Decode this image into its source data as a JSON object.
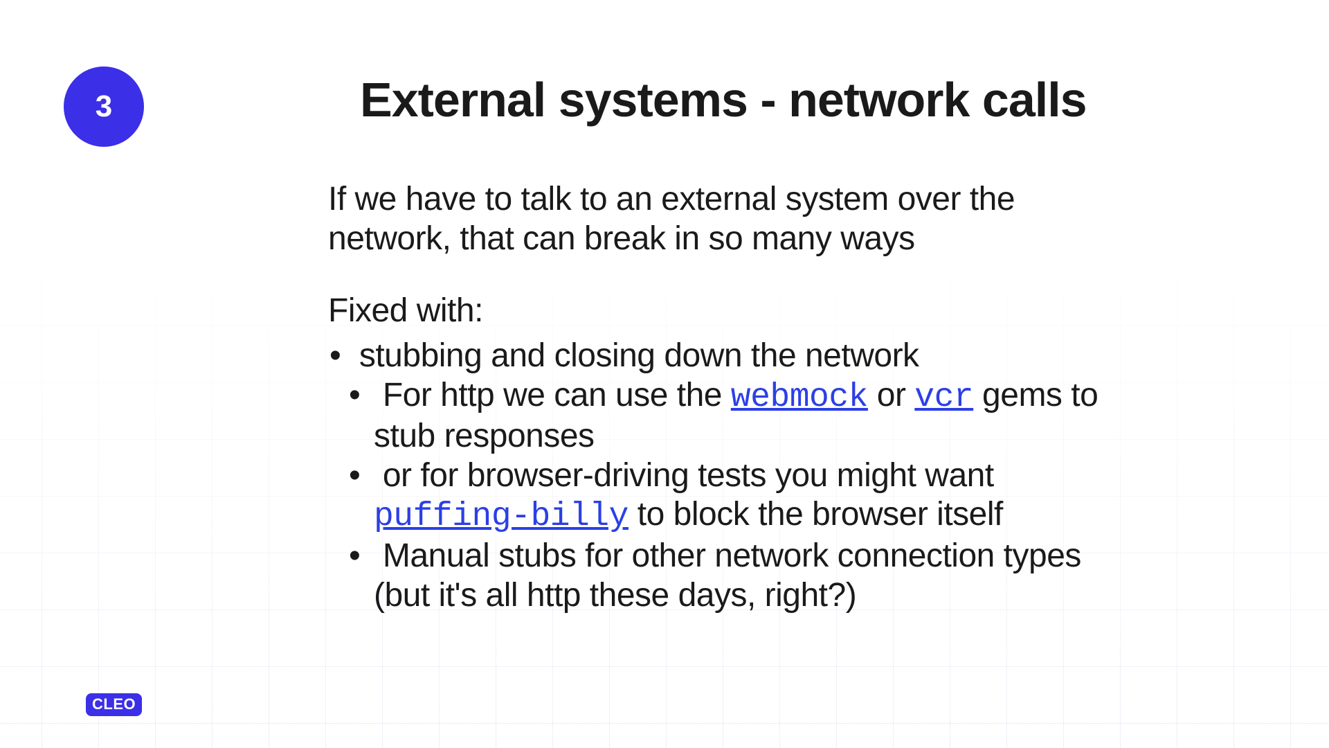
{
  "slide_number": "3",
  "title": "External systems - network calls",
  "intro": "If we have to talk to an external system over the network, that can break in so many ways",
  "fixed_with_label": "Fixed with:",
  "bullet1": "stubbing and closing down the network",
  "sub1_pre": "For http we can use the ",
  "sub1_link1": "webmock",
  "sub1_mid": " or ",
  "sub1_link2": "vcr",
  "sub1_post": " gems to stub responses",
  "sub2_pre": "or for browser-driving tests you might want ",
  "sub2_link": "puffing-billy",
  "sub2_post": " to block the browser itself",
  "sub3": "Manual stubs for other network connection types (but it's all http these days, right?)",
  "logo": "CLEO",
  "colors": {
    "accent": "#3b2fe8",
    "link": "#2b3fe6",
    "text": "#1a1a1a"
  }
}
